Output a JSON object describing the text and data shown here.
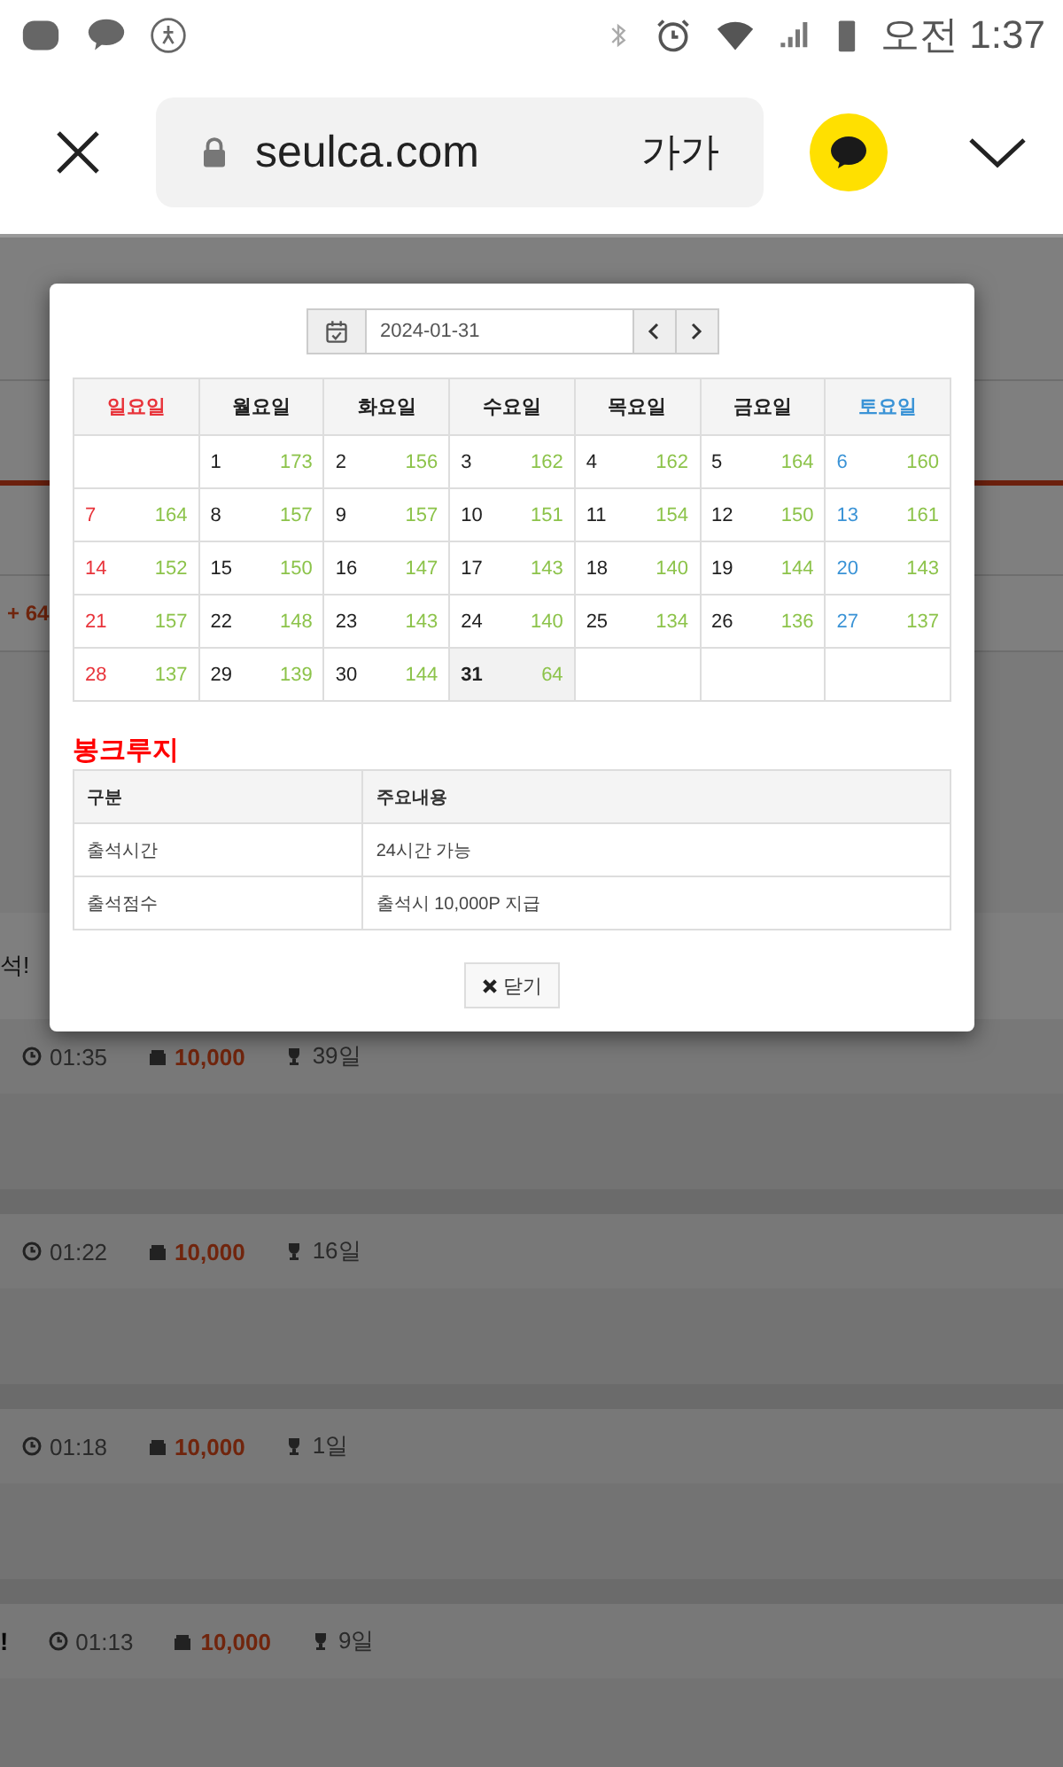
{
  "status_bar": {
    "time": "오전 1:37"
  },
  "browser": {
    "url": "seulca.com",
    "text_size": "가가"
  },
  "background": {
    "tab_fragment": "+ 64",
    "notice_fragment": "석!",
    "rows": [
      {
        "prefix": "",
        "time": "01:35",
        "points": "10,000",
        "days": "39일"
      },
      {
        "prefix": "",
        "time": "01:22",
        "points": "10,000",
        "days": "16일"
      },
      {
        "prefix": "",
        "time": "01:18",
        "points": "10,000",
        "days": "1일"
      },
      {
        "prefix": "!",
        "time": "01:13",
        "points": "10,000",
        "days": "9일"
      }
    ]
  },
  "modal": {
    "date": "2024-01-31",
    "weekdays": [
      {
        "label": "일요일",
        "kind": "sunday"
      },
      {
        "label": "월요일",
        "kind": "weekday"
      },
      {
        "label": "화요일",
        "kind": "weekday"
      },
      {
        "label": "수요일",
        "kind": "weekday"
      },
      {
        "label": "목요일",
        "kind": "weekday"
      },
      {
        "label": "금요일",
        "kind": "weekday"
      },
      {
        "label": "토요일",
        "kind": "saturday"
      }
    ],
    "weeks": [
      [
        {
          "kind": "blank"
        },
        {
          "kind": "day",
          "day": "1",
          "count": "173",
          "selected": false
        },
        {
          "kind": "day",
          "day": "2",
          "count": "156",
          "selected": false
        },
        {
          "kind": "day",
          "day": "3",
          "count": "162",
          "selected": false
        },
        {
          "kind": "day",
          "day": "4",
          "count": "162",
          "selected": false
        },
        {
          "kind": "day",
          "day": "5",
          "count": "164",
          "selected": false
        },
        {
          "kind": "day",
          "day": "6",
          "count": "160",
          "selected": false
        }
      ],
      [
        {
          "kind": "day",
          "day": "7",
          "count": "164",
          "selected": false
        },
        {
          "kind": "day",
          "day": "8",
          "count": "157",
          "selected": false
        },
        {
          "kind": "day",
          "day": "9",
          "count": "157",
          "selected": false
        },
        {
          "kind": "day",
          "day": "10",
          "count": "151",
          "selected": false
        },
        {
          "kind": "day",
          "day": "11",
          "count": "154",
          "selected": false
        },
        {
          "kind": "day",
          "day": "12",
          "count": "150",
          "selected": false
        },
        {
          "kind": "day",
          "day": "13",
          "count": "161",
          "selected": false
        }
      ],
      [
        {
          "kind": "day",
          "day": "14",
          "count": "152",
          "selected": false
        },
        {
          "kind": "day",
          "day": "15",
          "count": "150",
          "selected": false
        },
        {
          "kind": "day",
          "day": "16",
          "count": "147",
          "selected": false
        },
        {
          "kind": "day",
          "day": "17",
          "count": "143",
          "selected": false
        },
        {
          "kind": "day",
          "day": "18",
          "count": "140",
          "selected": false
        },
        {
          "kind": "day",
          "day": "19",
          "count": "144",
          "selected": false
        },
        {
          "kind": "day",
          "day": "20",
          "count": "143",
          "selected": false
        }
      ],
      [
        {
          "kind": "day",
          "day": "21",
          "count": "157",
          "selected": false
        },
        {
          "kind": "day",
          "day": "22",
          "count": "148",
          "selected": false
        },
        {
          "kind": "day",
          "day": "23",
          "count": "143",
          "selected": false
        },
        {
          "kind": "day",
          "day": "24",
          "count": "140",
          "selected": false
        },
        {
          "kind": "day",
          "day": "25",
          "count": "134",
          "selected": false
        },
        {
          "kind": "day",
          "day": "26",
          "count": "136",
          "selected": false
        },
        {
          "kind": "day",
          "day": "27",
          "count": "137",
          "selected": false
        }
      ],
      [
        {
          "kind": "day",
          "day": "28",
          "count": "137",
          "selected": false
        },
        {
          "kind": "day",
          "day": "29",
          "count": "139",
          "selected": false
        },
        {
          "kind": "day",
          "day": "30",
          "count": "144",
          "selected": false
        },
        {
          "kind": "day",
          "day": "31",
          "count": "64",
          "selected": true
        },
        {
          "kind": "blank"
        },
        {
          "kind": "blank"
        },
        {
          "kind": "blank"
        }
      ]
    ],
    "section_title": "봉크루지",
    "info_table": {
      "columns": [
        "구분",
        "주요내용"
      ],
      "rows": [
        [
          "출석시간",
          "24시간 가능"
        ],
        [
          "출석점수",
          "출석시 10,000P 지급"
        ]
      ]
    },
    "close_button": "닫기"
  }
}
